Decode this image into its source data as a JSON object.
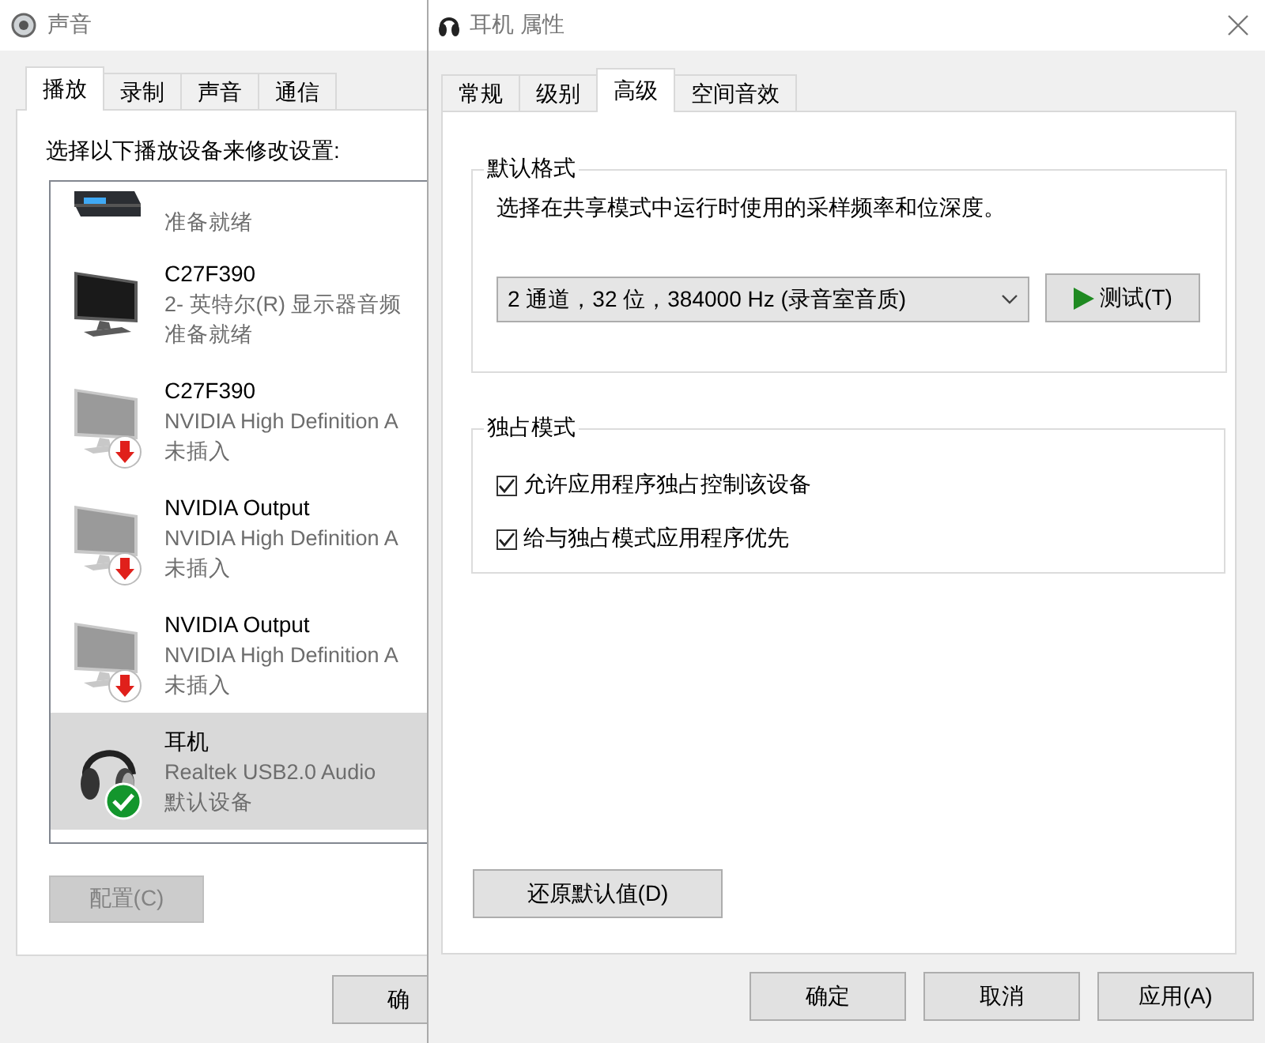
{
  "sound_window": {
    "title": "声音",
    "tabs": [
      {
        "label": "播放",
        "selected": true
      },
      {
        "label": "录制",
        "selected": false
      },
      {
        "label": "声音",
        "selected": false
      },
      {
        "label": "通信",
        "selected": false
      }
    ],
    "instruction": "选择以下播放设备来修改设置:",
    "devices": [
      {
        "kind": "receiver",
        "unplugged": false,
        "default": false,
        "status": "准备就绪",
        "selected": false
      },
      {
        "kind": "monitor",
        "unplugged": false,
        "default": false,
        "name": "C27F390",
        "description": "2- 英特尔(R) 显示器音频",
        "status": "准备就绪",
        "selected": false
      },
      {
        "kind": "monitor",
        "unplugged": true,
        "default": false,
        "name": "C27F390",
        "description": "NVIDIA High Definition A",
        "status": "未插入",
        "selected": false
      },
      {
        "kind": "monitor",
        "unplugged": true,
        "default": false,
        "name": "NVIDIA Output",
        "description": "NVIDIA High Definition A",
        "status": "未插入",
        "selected": false
      },
      {
        "kind": "monitor",
        "unplugged": true,
        "default": false,
        "name": "NVIDIA Output",
        "description": "NVIDIA High Definition A",
        "status": "未插入",
        "selected": false
      },
      {
        "kind": "headphones",
        "unplugged": false,
        "default": true,
        "name": "耳机",
        "description": "Realtek USB2.0 Audio",
        "status": "默认设备",
        "selected": true
      }
    ],
    "configure_button": {
      "label": "配置(C)",
      "disabled": true
    },
    "ok_button": "确"
  },
  "properties_window": {
    "title": "耳机 属性",
    "tabs": [
      {
        "label": "常规",
        "selected": false
      },
      {
        "label": "级别",
        "selected": false
      },
      {
        "label": "高级",
        "selected": true
      },
      {
        "label": "空间音效",
        "selected": false
      }
    ],
    "default_format": {
      "legend": "默认格式",
      "description": "选择在共享模式中运行时使用的采样频率和位深度。",
      "format": "2 通道，32 位，384000 Hz (录音室音质)",
      "test_button": "测试(T)"
    },
    "exclusive_mode": {
      "legend": "独占模式",
      "options": [
        {
          "label": "允许应用程序独占控制该设备",
          "checked": true
        },
        {
          "label": "给与独占模式应用程序优先",
          "checked": true
        }
      ]
    },
    "restore_button": "还原默认值(D)",
    "buttons": [
      "确定",
      "取消",
      "应用(A)"
    ]
  }
}
